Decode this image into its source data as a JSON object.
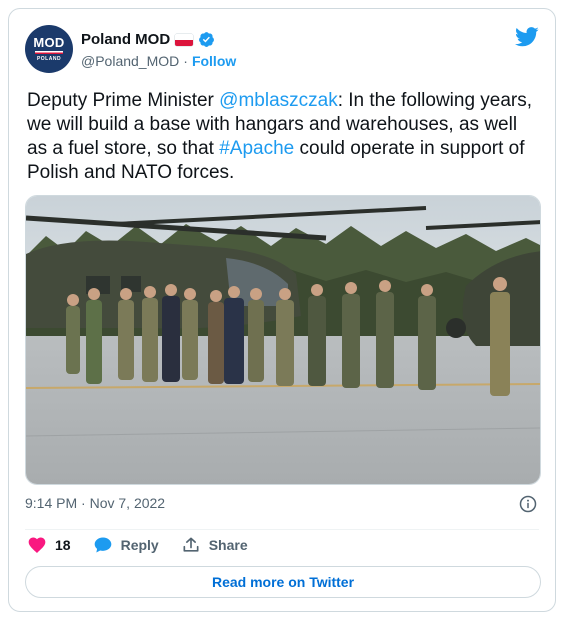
{
  "author": {
    "avatar": {
      "main": "MOD",
      "sub": "POLAND"
    },
    "display_name": "Poland MOD",
    "flag_colors": [
      "#ffffff",
      "#dc143c"
    ],
    "handle": "@Poland_MOD",
    "separator": "·",
    "follow_label": "Follow"
  },
  "tweet": {
    "text_1": "Deputy Prime Minister ",
    "mention": "@mblaszczak",
    "text_2": ": In the following years, we will build a base with hangars and warehouses, as well as a fuel store, so that ",
    "hashtag": "#Apache",
    "text_3": " could operate in support of Polish and NATO forces."
  },
  "photo": {
    "icon": "photo-of-helicopters-and-soldiers"
  },
  "meta": {
    "time": "9:14 PM",
    "separator": "·",
    "date": "Nov 7, 2022"
  },
  "actions": {
    "like_count": "18",
    "reply_label": "Reply",
    "share_label": "Share"
  },
  "read_more_label": "Read more on Twitter",
  "colors": {
    "accent": "#1d9bf0",
    "like": "#f91880",
    "text": "#0f1419",
    "muted": "#536471"
  }
}
